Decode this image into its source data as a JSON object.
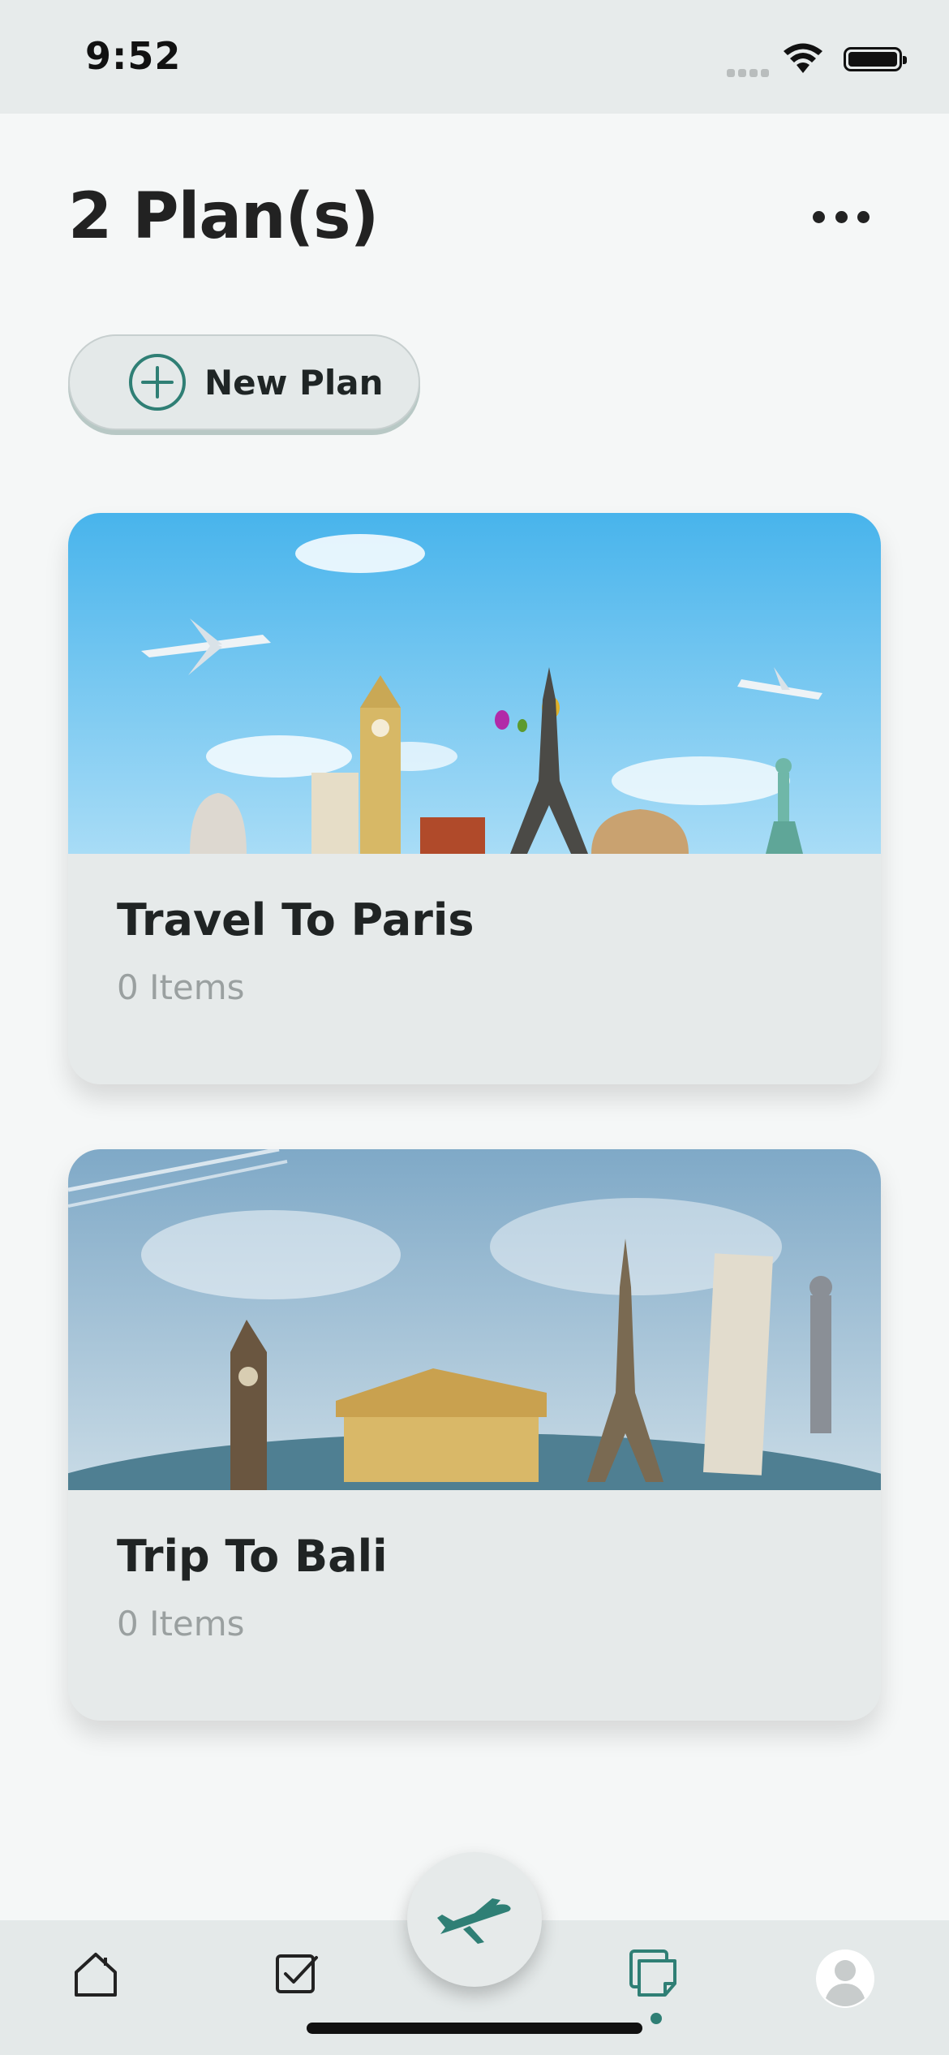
{
  "status_bar": {
    "time": "9:52"
  },
  "header": {
    "title": "2 Plan(s)",
    "more_icon": "ellipsis-icon"
  },
  "new_plan_button": {
    "label": "New Plan",
    "icon": "plus-circle-icon"
  },
  "plans": [
    {
      "title": "Travel To Paris",
      "count": "0 Items",
      "image": "world-landmarks-banner"
    },
    {
      "title": "Trip To Bali",
      "count": "0 Items",
      "image": "world-landmarks-globe"
    }
  ],
  "tab_bar": {
    "items": [
      "home-icon",
      "checklist-icon",
      "airplane-icon",
      "plans-icon",
      "profile-icon"
    ],
    "active": "plans-icon"
  },
  "colors": {
    "accent": "#2f7f75",
    "background": "#f5f7f7",
    "card": "#e6eaea"
  }
}
